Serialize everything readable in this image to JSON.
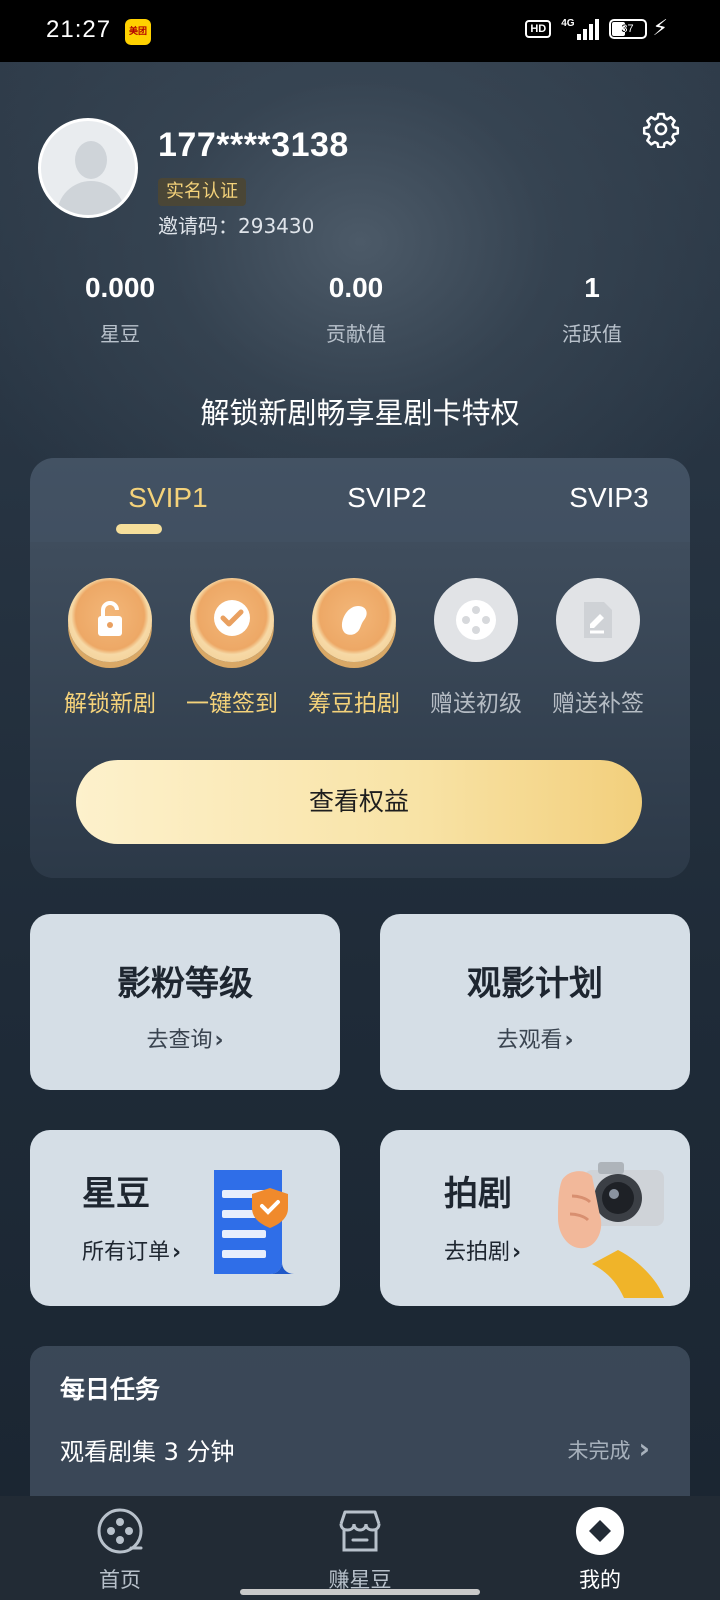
{
  "status_bar": {
    "time": "21:27",
    "app_badge": "美团",
    "hd_label": "HD",
    "network": "4G",
    "battery": "37"
  },
  "profile": {
    "phone": "177****3138",
    "verify_badge": "实名认证",
    "invite_label": "邀请码：",
    "invite_code": "293430"
  },
  "stats": [
    {
      "value": "0.000",
      "label": "星豆"
    },
    {
      "value": "0.00",
      "label": "贡献值"
    },
    {
      "value": "1",
      "label": "活跃值"
    }
  ],
  "promo_title": "解锁新剧畅享星剧卡特权",
  "vip": {
    "tabs": [
      "SVIP1",
      "SVIP2",
      "SVIP3"
    ],
    "active_tab": "SVIP1",
    "benefits": [
      {
        "label": "解锁新剧",
        "icon": "unlock-icon",
        "enabled": true
      },
      {
        "label": "一键签到",
        "icon": "check-icon",
        "enabled": true
      },
      {
        "label": "筹豆拍剧",
        "icon": "bean-icon",
        "enabled": true
      },
      {
        "label": "赠送初级",
        "icon": "film-reel-icon",
        "enabled": false
      },
      {
        "label": "赠送补签",
        "icon": "document-icon",
        "enabled": false
      }
    ],
    "cta": "查看权益"
  },
  "cards": {
    "fan_level": {
      "title": "影粉等级",
      "link": "去查询"
    },
    "watch_plan": {
      "title": "观影计划",
      "link": "去观看"
    },
    "beans": {
      "title": "星豆",
      "link": "所有订单"
    },
    "shoot": {
      "title": "拍剧",
      "link": "去拍剧"
    }
  },
  "daily_tasks": {
    "title": "每日任务",
    "items": [
      {
        "name": "观看剧集 3 分钟",
        "status": "未完成"
      }
    ]
  },
  "bottom_nav": [
    {
      "label": "首页",
      "icon": "film-reel-icon"
    },
    {
      "label": "赚星豆",
      "icon": "store-icon"
    },
    {
      "label": "我的",
      "icon": "diamond-icon"
    }
  ],
  "colors": {
    "gold_text": "#f4d27a",
    "card_bg": "#d5dee6",
    "background": "#1f2a36"
  }
}
